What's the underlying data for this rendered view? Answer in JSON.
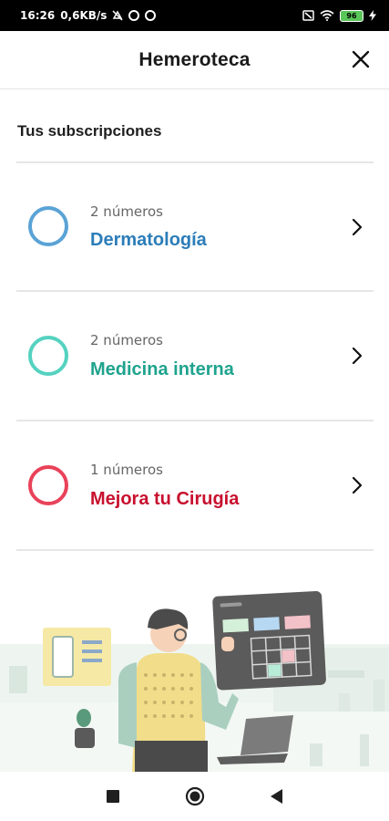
{
  "status_bar": {
    "time": "16:26",
    "network_speed": "0,6KB/s",
    "battery_level": "96",
    "icons": [
      "mute-icon",
      "sync-icon",
      "sync-icon",
      "sim-icon",
      "wifi-icon",
      "battery-icon",
      "charging-icon"
    ]
  },
  "header": {
    "title": "Hemeroteca",
    "close_icon": "close-icon"
  },
  "section": {
    "title": "Tus subscripciones"
  },
  "subscriptions": [
    {
      "count": "2 números",
      "name": "Dermatología",
      "color": "#5aa3d6",
      "name_color": "#2c7db8"
    },
    {
      "count": "2 números",
      "name": "Medicina interna",
      "color": "#55d2c0",
      "name_color": "#1fa38e"
    },
    {
      "count": "1 números",
      "name": "Mejora tu Cirugía",
      "color": "#e9425a",
      "name_color": "#c8102e"
    }
  ],
  "nav": {
    "icons": [
      "recent-apps-icon",
      "home-icon",
      "back-icon"
    ]
  },
  "colors": {
    "background": "#ffffff",
    "divider": "#e6e6e6"
  }
}
